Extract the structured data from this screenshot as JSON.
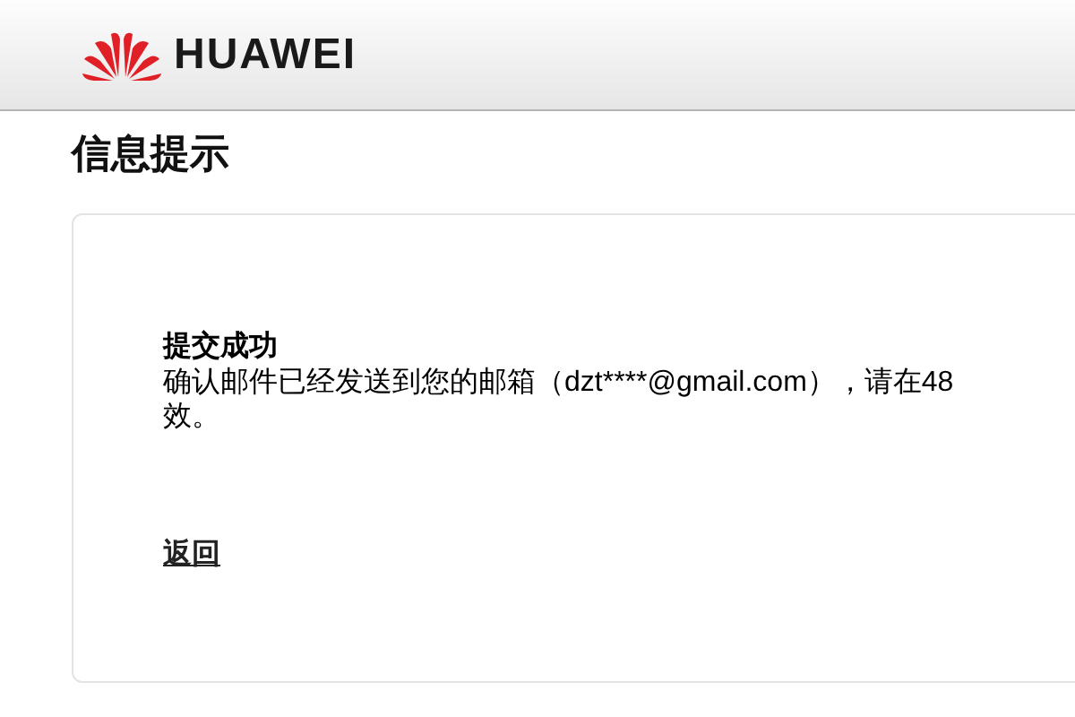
{
  "header": {
    "brand": "HUAWEI"
  },
  "page_title": "信息提示",
  "card": {
    "heading": "提交成功",
    "message_lines": [
      "确认邮件已经发送到您的邮箱（dzt****@gmail.com），请在48",
      "效。"
    ],
    "back_link": "返回"
  }
}
